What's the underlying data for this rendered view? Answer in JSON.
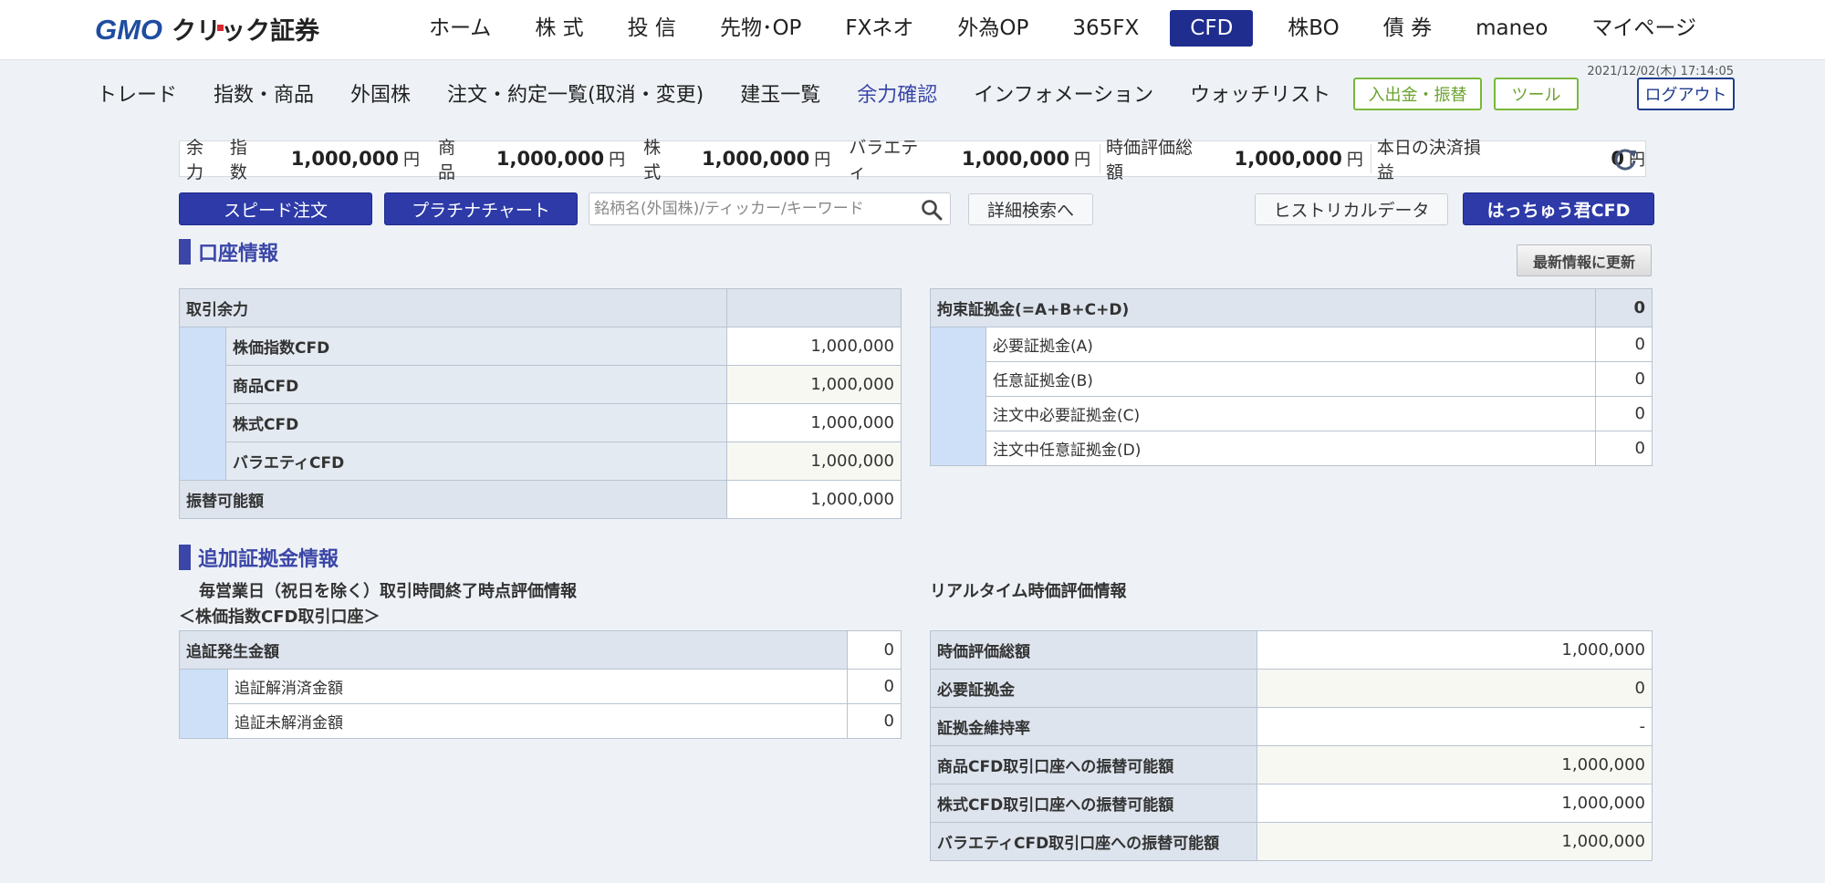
{
  "header": {
    "logo_text": "GMOクリック証券",
    "nav": [
      "ホーム",
      "株 式",
      "投 信",
      "先物･OP",
      "FXネオ",
      "外為OP",
      "365FX",
      "CFD",
      "株BO",
      "債 券",
      "maneo",
      "マイページ"
    ],
    "active_nav": "CFD",
    "datetime": "2021/12/02(木) 17:14:05"
  },
  "subnav": {
    "items": [
      "トレード",
      "指数・商品",
      "外国株",
      "注文・約定一覧(取消・変更)",
      "建玉一覧",
      "余力確認",
      "インフォメーション",
      "ウォッチリスト"
    ],
    "current": "余力確認",
    "deposit_label": "入出金・振替",
    "tool_label": "ツール",
    "logout_label": "ログアウト"
  },
  "summary": {
    "yoryoku_label": "余力",
    "index_label": "指数",
    "index_value": "1,000,000",
    "commodity_label": "商品",
    "commodity_value": "1,000,000",
    "stock_label": "株式",
    "stock_value": "1,000,000",
    "variety_label": "バラエティ",
    "variety_value": "1,000,000",
    "valuation_label": "時価評価総額",
    "valuation_value": "1,000,000",
    "pnl_label": "本日の決済損益",
    "pnl_value": "0",
    "unit": "円"
  },
  "actions": {
    "speed_order": "スピード注文",
    "platinum_chart": "プラチナチャート",
    "search_placeholder": "銘柄名(外国株)/ティッカー/キーワード",
    "detail_search": "詳細検索へ",
    "historical_data": "ヒストリカルデータ",
    "hacchu_cfd": "はっちゅう君CFD",
    "update_latest": "最新情報に更新"
  },
  "account_info": {
    "title": "口座情報",
    "trading_capacity": {
      "header": "取引余力",
      "rows": [
        {
          "label": "株価指数CFD",
          "value": "1,000,000"
        },
        {
          "label": "商品CFD",
          "value": "1,000,000"
        },
        {
          "label": "株式CFD",
          "value": "1,000,000"
        },
        {
          "label": "バラエティCFD",
          "value": "1,000,000"
        }
      ],
      "transferable_label": "振替可能額",
      "transferable_value": "1,000,000"
    },
    "margin": {
      "header": "拘束証拠金(=A+B+C+D)",
      "header_value": "0",
      "rows": [
        {
          "label": "必要証拠金(A)",
          "value": "0"
        },
        {
          "label": "任意証拠金(B)",
          "value": "0"
        },
        {
          "label": "注文中必要証拠金(C)",
          "value": "0"
        },
        {
          "label": "注文中任意証拠金(D)",
          "value": "0"
        }
      ]
    }
  },
  "additional_margin": {
    "title": "追加証拠金情報",
    "left_heading_1": "毎営業日（祝日を除く）取引時間終了時点評価情報",
    "left_heading_2": "＜株価指数CFD取引口座＞",
    "left_table": {
      "header": "追証発生金額",
      "header_value": "0",
      "rows": [
        {
          "label": "追証解消済金額",
          "value": "0"
        },
        {
          "label": "追証未解消金額",
          "value": "0"
        }
      ]
    },
    "right_heading": "リアルタイム時価評価情報",
    "right_table": [
      {
        "label": "時価評価総額",
        "value": "1,000,000"
      },
      {
        "label": "必要証拠金",
        "value": "0"
      },
      {
        "label": "証拠金維持率",
        "value": "-"
      },
      {
        "label": "商品CFD取引口座への振替可能額",
        "value": "1,000,000"
      },
      {
        "label": "株式CFD取引口座への振替可能額",
        "value": "1,000,000"
      },
      {
        "label": "バラエティCFD取引口座への振替可能額",
        "value": "1,000,000"
      }
    ]
  },
  "colors": {
    "brand_navy": "#1f2d8f",
    "accent_blue": "#3b46a8",
    "green": "#7ab83a",
    "header_cell": "#dde4ee",
    "indent_cell": "#cde0f8"
  }
}
